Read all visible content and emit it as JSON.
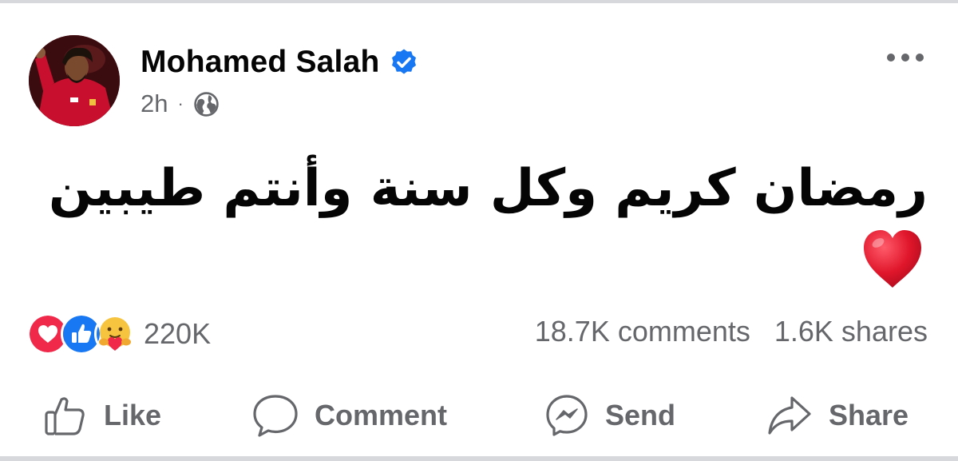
{
  "post": {
    "author": "Mohamed Salah",
    "time": "2h",
    "separator": "·",
    "text": "رمضان كريم وكل سنة وأنتم طيبين"
  },
  "stats": {
    "reactions_count": "220K",
    "comments": "18.7K comments",
    "shares": "1.6K shares"
  },
  "actions": {
    "like": "Like",
    "comment": "Comment",
    "send": "Send",
    "share": "Share"
  },
  "colors": {
    "verified": "#1877f2",
    "love": "#f02849",
    "like": "#1877f2",
    "heart_emoji": "#e0162b",
    "muted_text": "#65676b"
  }
}
